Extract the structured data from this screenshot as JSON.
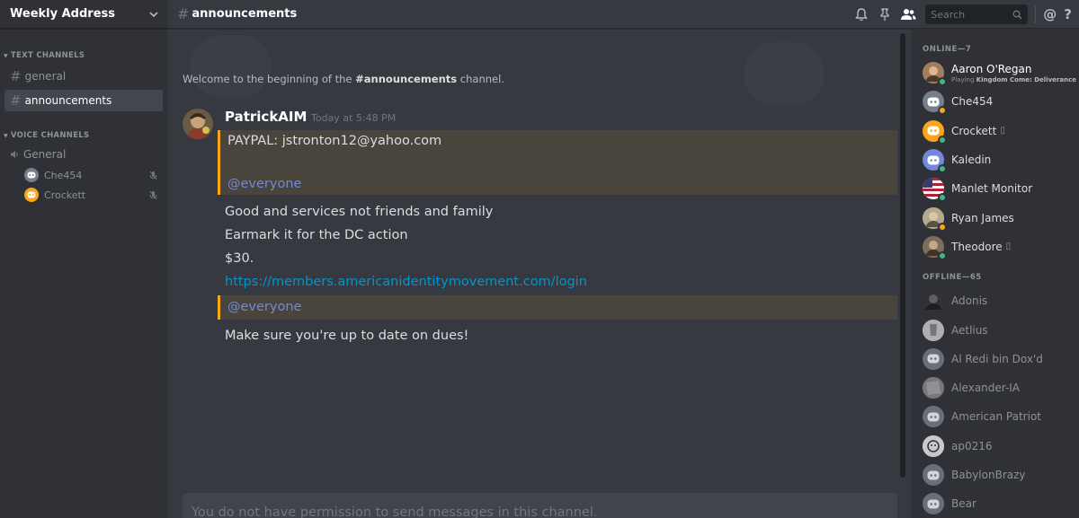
{
  "sidebar": {
    "server_name": "Weekly Address",
    "text_category": "TEXT CHANNELS",
    "voice_category": "VOICE CHANNELS",
    "text_channels": [
      "general",
      "announcements"
    ],
    "voice_channel": "General",
    "voice_users": [
      "Che454",
      "Crockett"
    ]
  },
  "topbar": {
    "channel": "announcements",
    "search_placeholder": "Search",
    "mention_label": "@",
    "help_label": "?"
  },
  "chat": {
    "welcome_prefix": "Welcome to the beginning of the ",
    "welcome_channel": "#announcements",
    "welcome_suffix": " channel.",
    "author": "PatrickAIM",
    "timestamp": "Today at 5:48 PM",
    "lines": {
      "paypal": "PAYPAL: jstronton12@yahoo.com",
      "mention1": "@everyone",
      "l1": "Good and services not friends and family",
      "l2": "Earmark it for the DC action",
      "l3": "$30.",
      "link": "https://members.americanidentitymovement.com/login",
      "mention2": "@everyone",
      "l4": "Make sure you're up to date on dues!"
    },
    "composer": "You do not have permission to send messages in this channel."
  },
  "members": {
    "online_header": "ONLINE—7",
    "offline_header": "OFFLINE—65",
    "online": [
      {
        "name": "Aaron O'Regan",
        "activity_prefix": "Playing ",
        "activity": "Kingdom Come: Deliverance",
        "status": "online"
      },
      {
        "name": "Che454",
        "status": "idle"
      },
      {
        "name": "Crockett",
        "status": "online",
        "mobile": true
      },
      {
        "name": "Kaledin",
        "status": "online"
      },
      {
        "name": "Manlet Monitor",
        "status": "online"
      },
      {
        "name": "Ryan James",
        "status": "idle"
      },
      {
        "name": "Theodore",
        "status": "online",
        "mobile": true
      }
    ],
    "offline": [
      "Adonis",
      "Aetlius",
      "Al Redi bin Dox'd",
      "Alexander-IA",
      "American Patriot",
      "ap0216",
      "BabylonBrazy",
      "Bear"
    ]
  },
  "colors": {
    "online": "#43b581",
    "idle": "#faa61a",
    "blurple": "#7289da",
    "mention_bg": "#49443c"
  }
}
